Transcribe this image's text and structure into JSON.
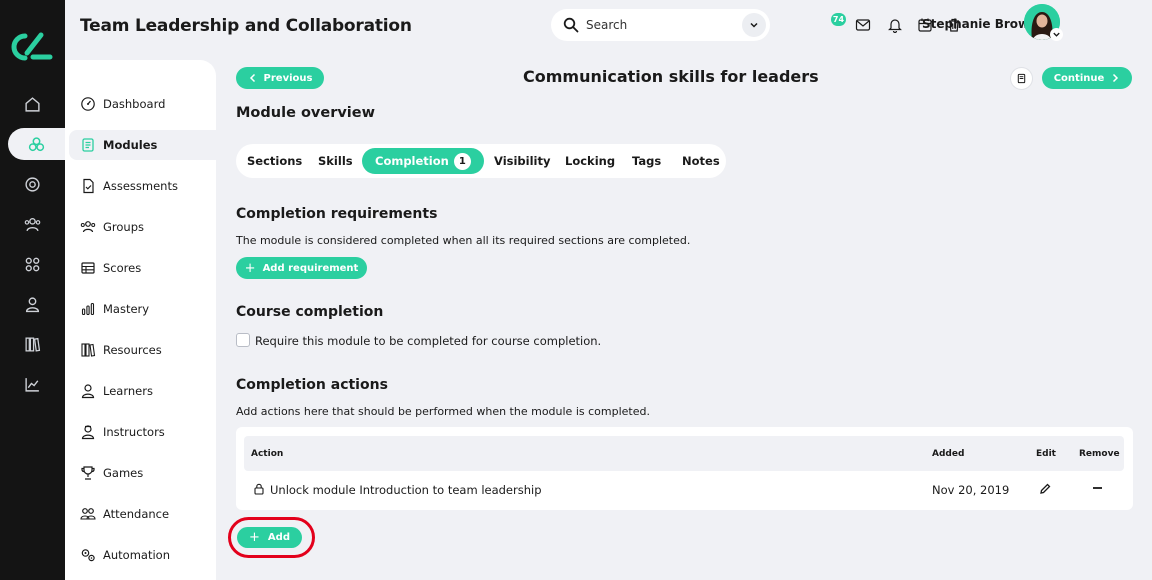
{
  "app": {
    "title": "Team Leadership and Collaboration"
  },
  "search": {
    "placeholder": "Search"
  },
  "header": {
    "notification_count": "74",
    "user_name": "Stephanie Brown"
  },
  "sidebar": {
    "items": [
      {
        "label": "Dashboard",
        "icon": "dashboard-icon"
      },
      {
        "label": "Modules",
        "icon": "modules-icon",
        "active": true
      },
      {
        "label": "Assessments",
        "icon": "assessments-icon"
      },
      {
        "label": "Groups",
        "icon": "groups-icon"
      },
      {
        "label": "Scores",
        "icon": "scores-icon"
      },
      {
        "label": "Mastery",
        "icon": "mastery-icon"
      },
      {
        "label": "Resources",
        "icon": "resources-icon"
      },
      {
        "label": "Learners",
        "icon": "learners-icon"
      },
      {
        "label": "Instructors",
        "icon": "instructors-icon"
      },
      {
        "label": "Games",
        "icon": "games-icon"
      },
      {
        "label": "Attendance",
        "icon": "attendance-icon"
      },
      {
        "label": "Automation",
        "icon": "automation-icon"
      }
    ]
  },
  "nav": {
    "previous_label": "Previous",
    "continue_label": "Continue",
    "page_title": "Communication skills for leaders"
  },
  "main": {
    "overview_title": "Module overview",
    "tabs": [
      {
        "label": "Sections"
      },
      {
        "label": "Skills"
      },
      {
        "label": "Completion",
        "badge": "1",
        "active": true
      },
      {
        "label": "Visibility"
      },
      {
        "label": "Locking"
      },
      {
        "label": "Tags"
      },
      {
        "label": "Notes"
      }
    ],
    "requirements": {
      "title": "Completion requirements",
      "description": "The module is considered completed when all its required sections are completed.",
      "button_label": "Add requirement"
    },
    "course_completion": {
      "title": "Course completion",
      "checkbox_label": "Require this module to be completed for course completion.",
      "checked": false
    },
    "actions": {
      "title": "Completion actions",
      "description": "Add actions here that should be performed when the module is completed.",
      "columns": {
        "action": "Action",
        "added": "Added",
        "edit": "Edit",
        "remove": "Remove"
      },
      "rows": [
        {
          "action": "Unlock module Introduction to team leadership",
          "added": "Nov 20, 2019"
        }
      ],
      "add_label": "Add"
    }
  },
  "colors": {
    "accent": "#2bcfa0",
    "rail": "#141414",
    "background": "#f0f1f5",
    "highlight": "#e3001b"
  }
}
